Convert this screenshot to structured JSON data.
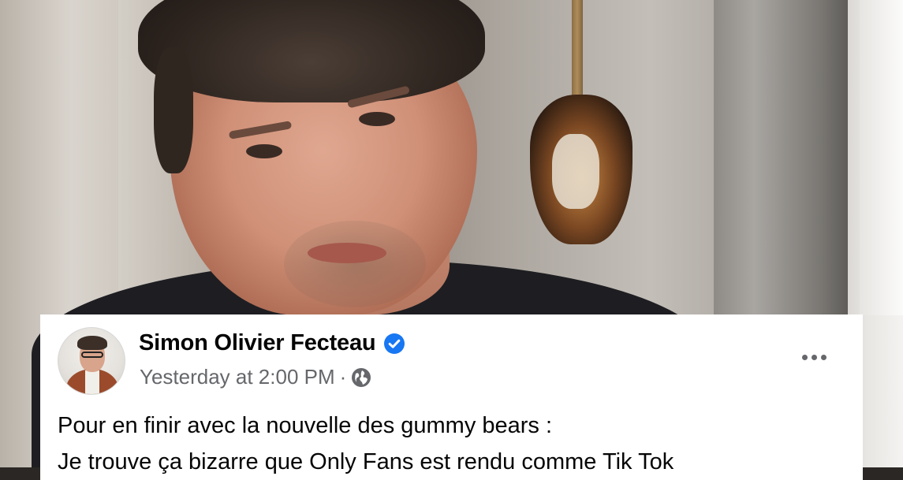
{
  "post": {
    "author_name": "Simon Olivier Fecteau",
    "verified": true,
    "timestamp": "Yesterday at 2:00 PM",
    "separator": "·",
    "privacy_icon": "globe-icon",
    "more_icon": "more-options-icon",
    "paragraphs": [
      "Pour en finir avec la nouvelle des gummy bears :",
      "Je trouve ça bizarre que Only Fans est rendu comme Tik Tok"
    ]
  },
  "colors": {
    "verified_blue": "#1877f2",
    "secondary_text": "#65676b",
    "primary_text": "#050505",
    "card_background": "#ffffff"
  }
}
